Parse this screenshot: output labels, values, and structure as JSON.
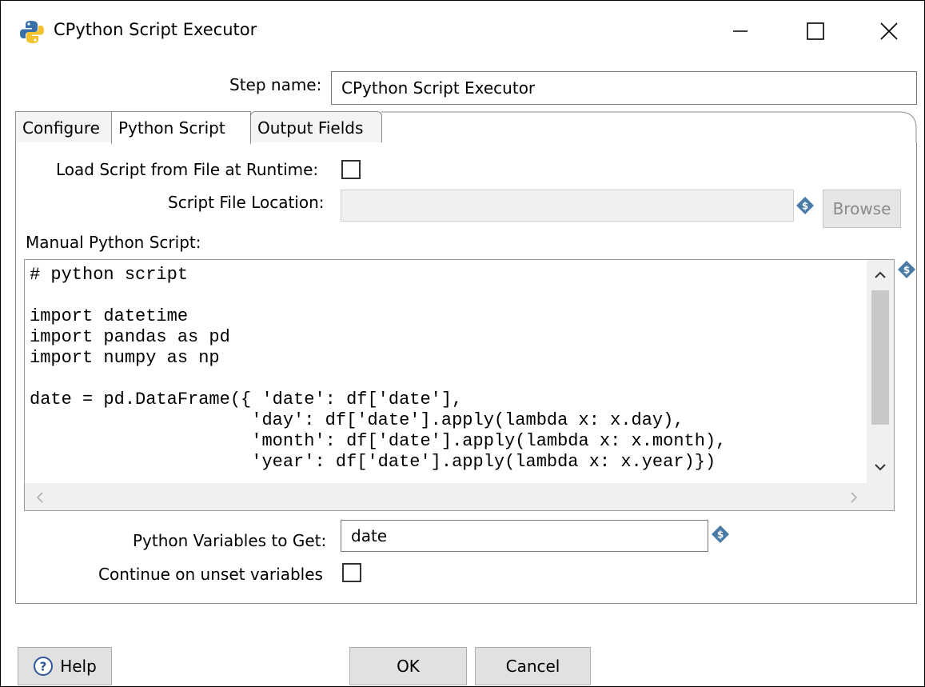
{
  "window": {
    "title": "CPython Script Executor",
    "controls": [
      "minimize",
      "maximize",
      "close"
    ]
  },
  "step_name": {
    "label": "Step name:",
    "value": "CPython Script Executor"
  },
  "tabs": [
    {
      "label": "Configure",
      "active": false
    },
    {
      "label": "Python Script",
      "active": true
    },
    {
      "label": "Output Fields",
      "active": false
    }
  ],
  "python_script": {
    "load_from_file_label": "Load Script from File at Runtime:",
    "load_from_file_checked": false,
    "file_location_label": "Script File Location:",
    "file_location_value": "",
    "browse_label": "Browse",
    "manual_script_label": "Manual Python Script:",
    "code_lines": [
      "# python script",
      "",
      "import datetime",
      "import pandas as pd",
      "import numpy as np",
      "",
      "date = pd.DataFrame({ 'date': df['date'],",
      "                     'day': df['date'].apply(lambda x: x.day),",
      "                     'month': df['date'].apply(lambda x: x.month),",
      "                     'year': df['date'].apply(lambda x: x.year)})"
    ],
    "variables_label": "Python Variables to Get:",
    "variables_value": "date",
    "continue_label": "Continue on unset variables",
    "continue_checked": false
  },
  "buttons": {
    "help": "Help",
    "ok": "OK",
    "cancel": "Cancel"
  },
  "icons": {
    "app": "python-icon",
    "variable": "variable-diamond-icon",
    "help": "question-circle-icon"
  },
  "colors": {
    "variable_icon": "#4a7aa6",
    "disabled_text": "#8a8a8a"
  }
}
